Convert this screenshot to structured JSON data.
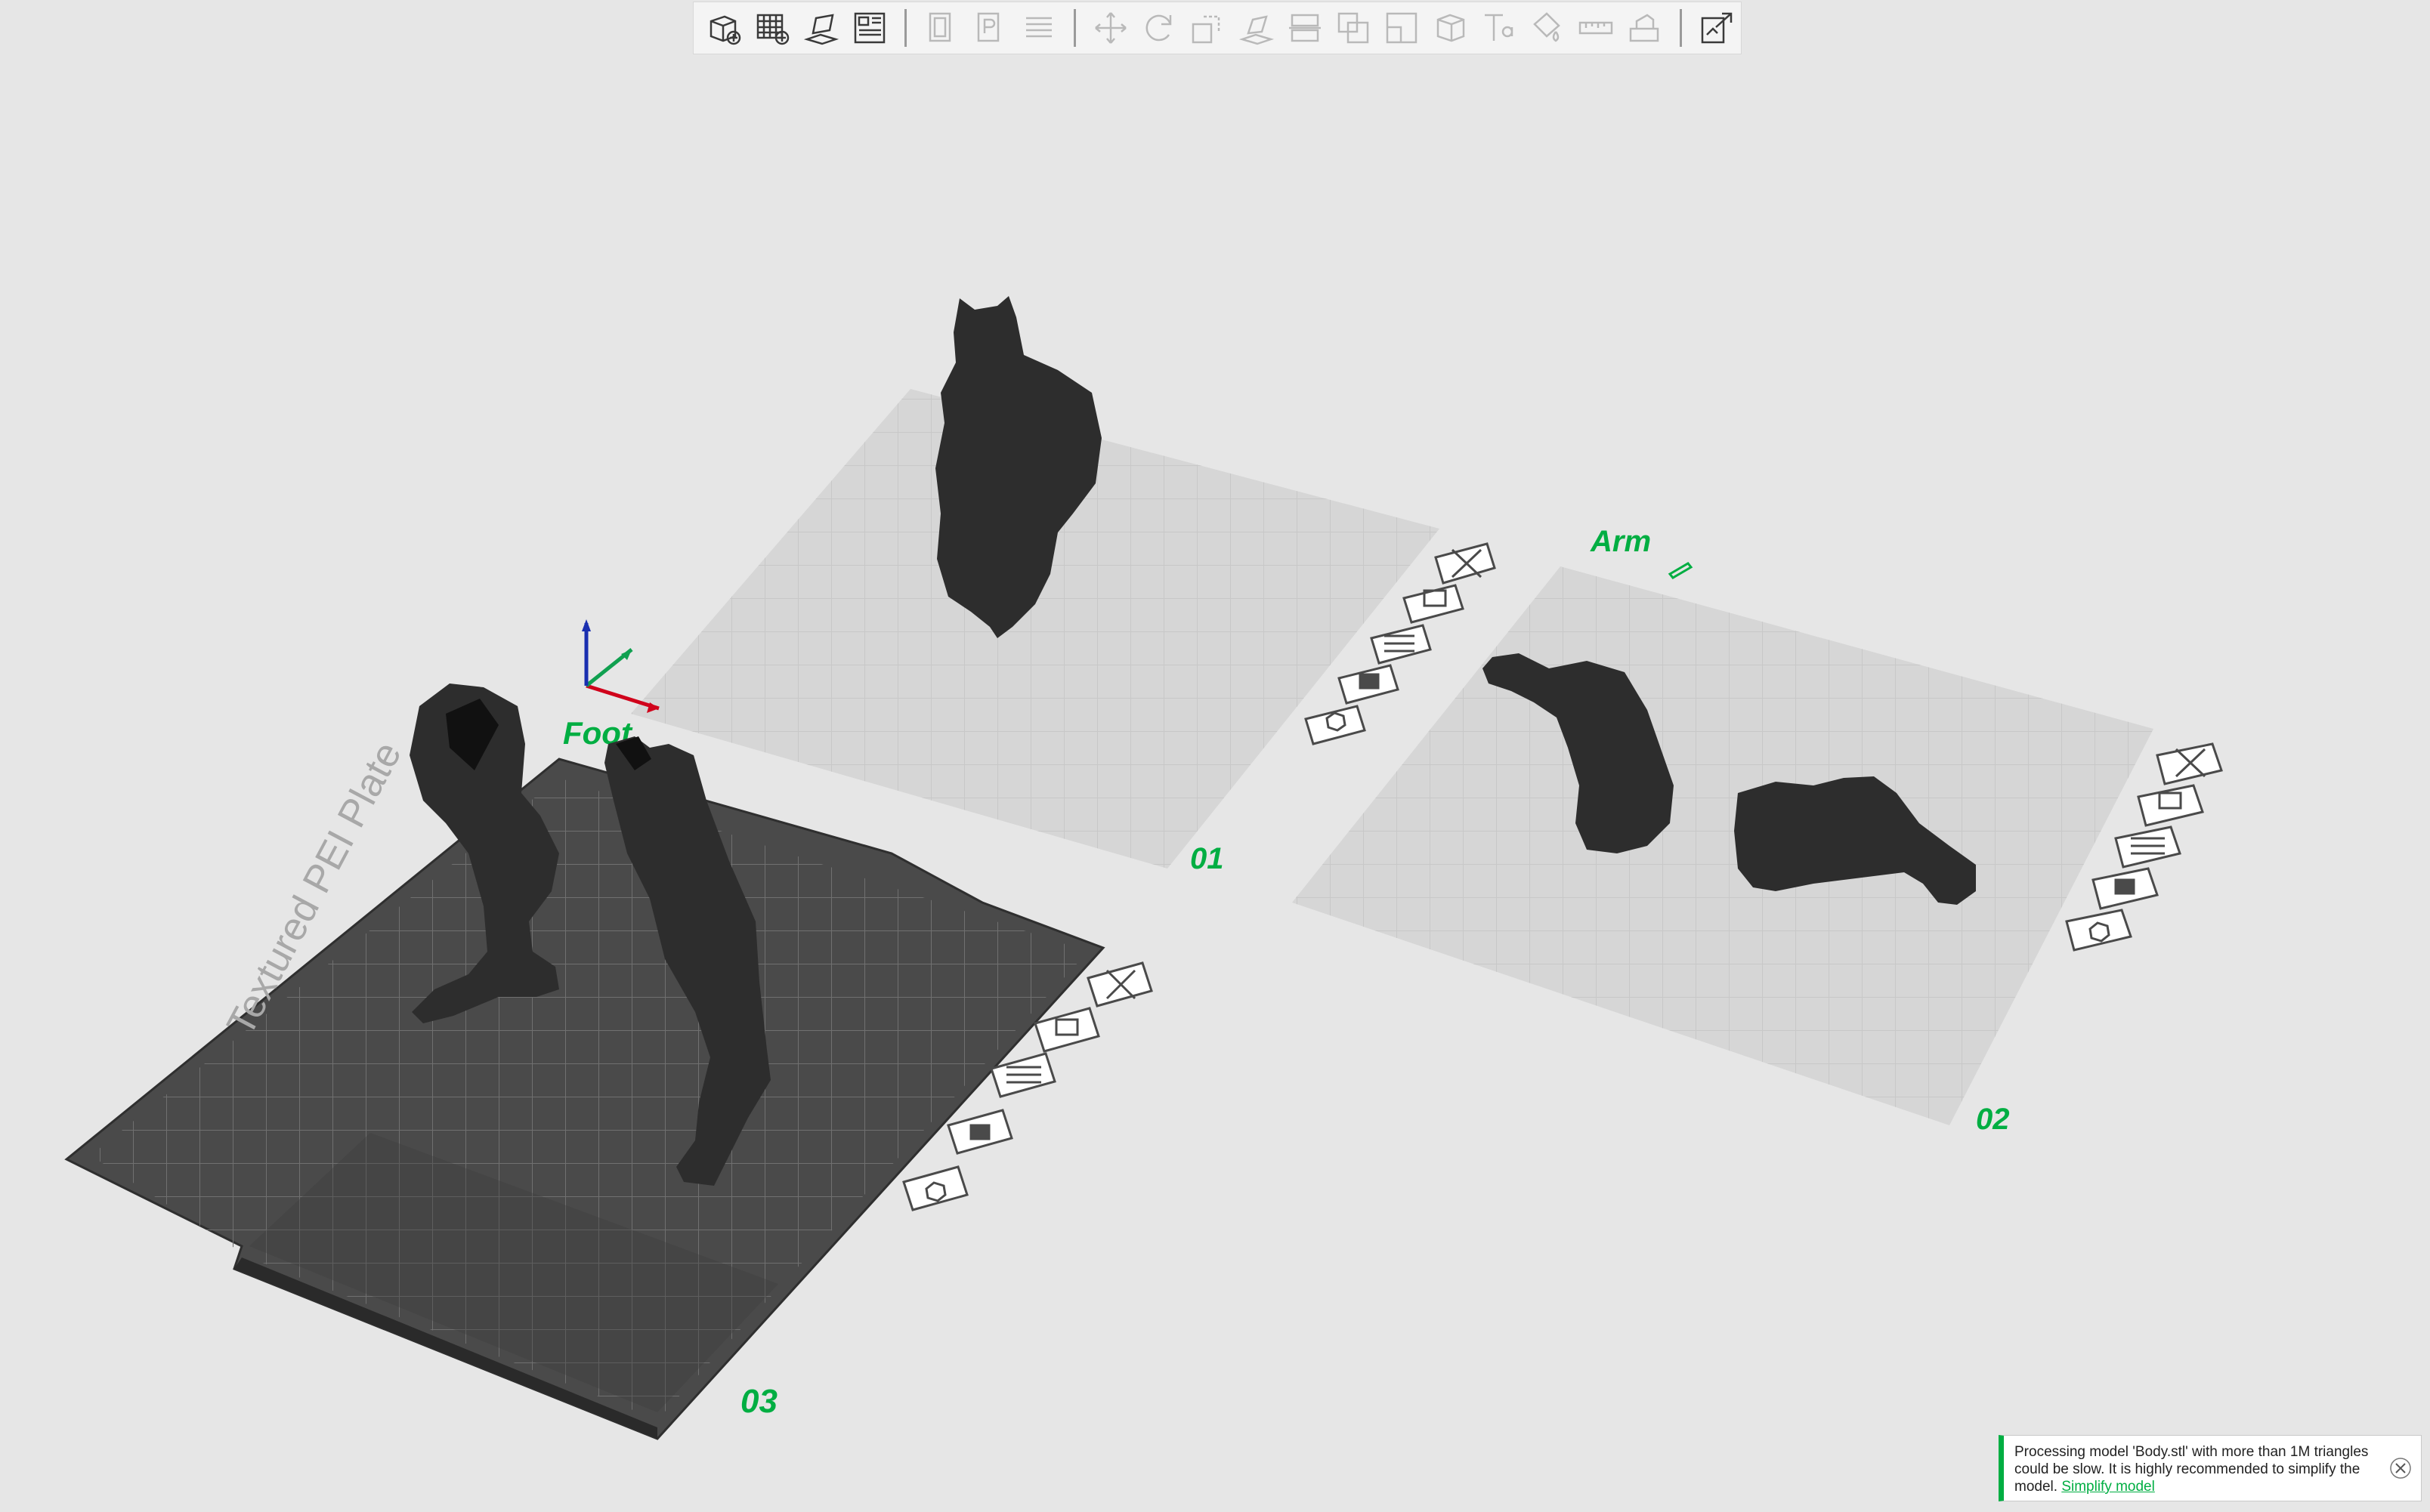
{
  "toolbar": {
    "groups": [
      [
        {
          "name": "add-object-icon",
          "state": "active"
        },
        {
          "name": "add-plate-icon",
          "state": "active"
        },
        {
          "name": "auto-orient-icon",
          "state": "active"
        },
        {
          "name": "arrange-icon",
          "state": "active"
        }
      ],
      [
        {
          "name": "split-objects-icon",
          "state": "disabled"
        },
        {
          "name": "split-parts-icon",
          "state": "disabled"
        },
        {
          "name": "layers-icon",
          "state": "disabled"
        }
      ],
      [
        {
          "name": "move-icon",
          "state": "disabled"
        },
        {
          "name": "rotate-icon",
          "state": "disabled"
        },
        {
          "name": "scale-icon",
          "state": "disabled"
        },
        {
          "name": "lay-on-face-icon",
          "state": "disabled"
        },
        {
          "name": "cut-icon",
          "state": "disabled"
        },
        {
          "name": "boolean-icon",
          "state": "disabled"
        },
        {
          "name": "support-paint-icon",
          "state": "disabled"
        },
        {
          "name": "seam-paint-icon",
          "state": "disabled"
        },
        {
          "name": "text-shape-icon",
          "state": "disabled"
        },
        {
          "name": "color-paint-icon",
          "state": "disabled"
        },
        {
          "name": "measure-icon",
          "state": "disabled"
        },
        {
          "name": "assembly-icon",
          "state": "disabled"
        }
      ],
      [
        {
          "name": "assembly-view-icon",
          "state": "active"
        }
      ]
    ]
  },
  "plates": {
    "p1": {
      "number": "01",
      "name_visible": ""
    },
    "p2": {
      "number": "02",
      "name": "Arm"
    },
    "p3": {
      "number": "03",
      "name": "Foot",
      "bed_text": "Textured PEI Plate"
    }
  },
  "notification": {
    "message": "Processing model 'Body.stl' with more than 1M triangles could be slow. It is highly recommended to simplify the model.",
    "link": "Simplify model"
  },
  "colors": {
    "accent": "#00ae42",
    "background": "#e6e6e6",
    "plate_light": "#d6d6d6",
    "plate_dark": "#4a4a4a",
    "model": "#2d2d2d"
  }
}
